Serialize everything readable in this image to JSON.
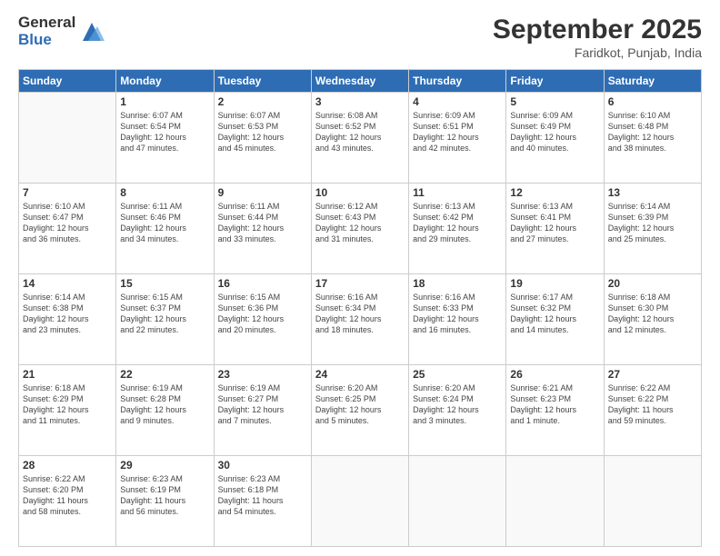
{
  "logo": {
    "general": "General",
    "blue": "Blue"
  },
  "header": {
    "month": "September 2025",
    "location": "Faridkot, Punjab, India"
  },
  "days": [
    "Sunday",
    "Monday",
    "Tuesday",
    "Wednesday",
    "Thursday",
    "Friday",
    "Saturday"
  ],
  "weeks": [
    [
      {
        "day": "",
        "info": ""
      },
      {
        "day": "1",
        "info": "Sunrise: 6:07 AM\nSunset: 6:54 PM\nDaylight: 12 hours\nand 47 minutes."
      },
      {
        "day": "2",
        "info": "Sunrise: 6:07 AM\nSunset: 6:53 PM\nDaylight: 12 hours\nand 45 minutes."
      },
      {
        "day": "3",
        "info": "Sunrise: 6:08 AM\nSunset: 6:52 PM\nDaylight: 12 hours\nand 43 minutes."
      },
      {
        "day": "4",
        "info": "Sunrise: 6:09 AM\nSunset: 6:51 PM\nDaylight: 12 hours\nand 42 minutes."
      },
      {
        "day": "5",
        "info": "Sunrise: 6:09 AM\nSunset: 6:49 PM\nDaylight: 12 hours\nand 40 minutes."
      },
      {
        "day": "6",
        "info": "Sunrise: 6:10 AM\nSunset: 6:48 PM\nDaylight: 12 hours\nand 38 minutes."
      }
    ],
    [
      {
        "day": "7",
        "info": "Sunrise: 6:10 AM\nSunset: 6:47 PM\nDaylight: 12 hours\nand 36 minutes."
      },
      {
        "day": "8",
        "info": "Sunrise: 6:11 AM\nSunset: 6:46 PM\nDaylight: 12 hours\nand 34 minutes."
      },
      {
        "day": "9",
        "info": "Sunrise: 6:11 AM\nSunset: 6:44 PM\nDaylight: 12 hours\nand 33 minutes."
      },
      {
        "day": "10",
        "info": "Sunrise: 6:12 AM\nSunset: 6:43 PM\nDaylight: 12 hours\nand 31 minutes."
      },
      {
        "day": "11",
        "info": "Sunrise: 6:13 AM\nSunset: 6:42 PM\nDaylight: 12 hours\nand 29 minutes."
      },
      {
        "day": "12",
        "info": "Sunrise: 6:13 AM\nSunset: 6:41 PM\nDaylight: 12 hours\nand 27 minutes."
      },
      {
        "day": "13",
        "info": "Sunrise: 6:14 AM\nSunset: 6:39 PM\nDaylight: 12 hours\nand 25 minutes."
      }
    ],
    [
      {
        "day": "14",
        "info": "Sunrise: 6:14 AM\nSunset: 6:38 PM\nDaylight: 12 hours\nand 23 minutes."
      },
      {
        "day": "15",
        "info": "Sunrise: 6:15 AM\nSunset: 6:37 PM\nDaylight: 12 hours\nand 22 minutes."
      },
      {
        "day": "16",
        "info": "Sunrise: 6:15 AM\nSunset: 6:36 PM\nDaylight: 12 hours\nand 20 minutes."
      },
      {
        "day": "17",
        "info": "Sunrise: 6:16 AM\nSunset: 6:34 PM\nDaylight: 12 hours\nand 18 minutes."
      },
      {
        "day": "18",
        "info": "Sunrise: 6:16 AM\nSunset: 6:33 PM\nDaylight: 12 hours\nand 16 minutes."
      },
      {
        "day": "19",
        "info": "Sunrise: 6:17 AM\nSunset: 6:32 PM\nDaylight: 12 hours\nand 14 minutes."
      },
      {
        "day": "20",
        "info": "Sunrise: 6:18 AM\nSunset: 6:30 PM\nDaylight: 12 hours\nand 12 minutes."
      }
    ],
    [
      {
        "day": "21",
        "info": "Sunrise: 6:18 AM\nSunset: 6:29 PM\nDaylight: 12 hours\nand 11 minutes."
      },
      {
        "day": "22",
        "info": "Sunrise: 6:19 AM\nSunset: 6:28 PM\nDaylight: 12 hours\nand 9 minutes."
      },
      {
        "day": "23",
        "info": "Sunrise: 6:19 AM\nSunset: 6:27 PM\nDaylight: 12 hours\nand 7 minutes."
      },
      {
        "day": "24",
        "info": "Sunrise: 6:20 AM\nSunset: 6:25 PM\nDaylight: 12 hours\nand 5 minutes."
      },
      {
        "day": "25",
        "info": "Sunrise: 6:20 AM\nSunset: 6:24 PM\nDaylight: 12 hours\nand 3 minutes."
      },
      {
        "day": "26",
        "info": "Sunrise: 6:21 AM\nSunset: 6:23 PM\nDaylight: 12 hours\nand 1 minute."
      },
      {
        "day": "27",
        "info": "Sunrise: 6:22 AM\nSunset: 6:22 PM\nDaylight: 11 hours\nand 59 minutes."
      }
    ],
    [
      {
        "day": "28",
        "info": "Sunrise: 6:22 AM\nSunset: 6:20 PM\nDaylight: 11 hours\nand 58 minutes."
      },
      {
        "day": "29",
        "info": "Sunrise: 6:23 AM\nSunset: 6:19 PM\nDaylight: 11 hours\nand 56 minutes."
      },
      {
        "day": "30",
        "info": "Sunrise: 6:23 AM\nSunset: 6:18 PM\nDaylight: 11 hours\nand 54 minutes."
      },
      {
        "day": "",
        "info": ""
      },
      {
        "day": "",
        "info": ""
      },
      {
        "day": "",
        "info": ""
      },
      {
        "day": "",
        "info": ""
      }
    ]
  ]
}
